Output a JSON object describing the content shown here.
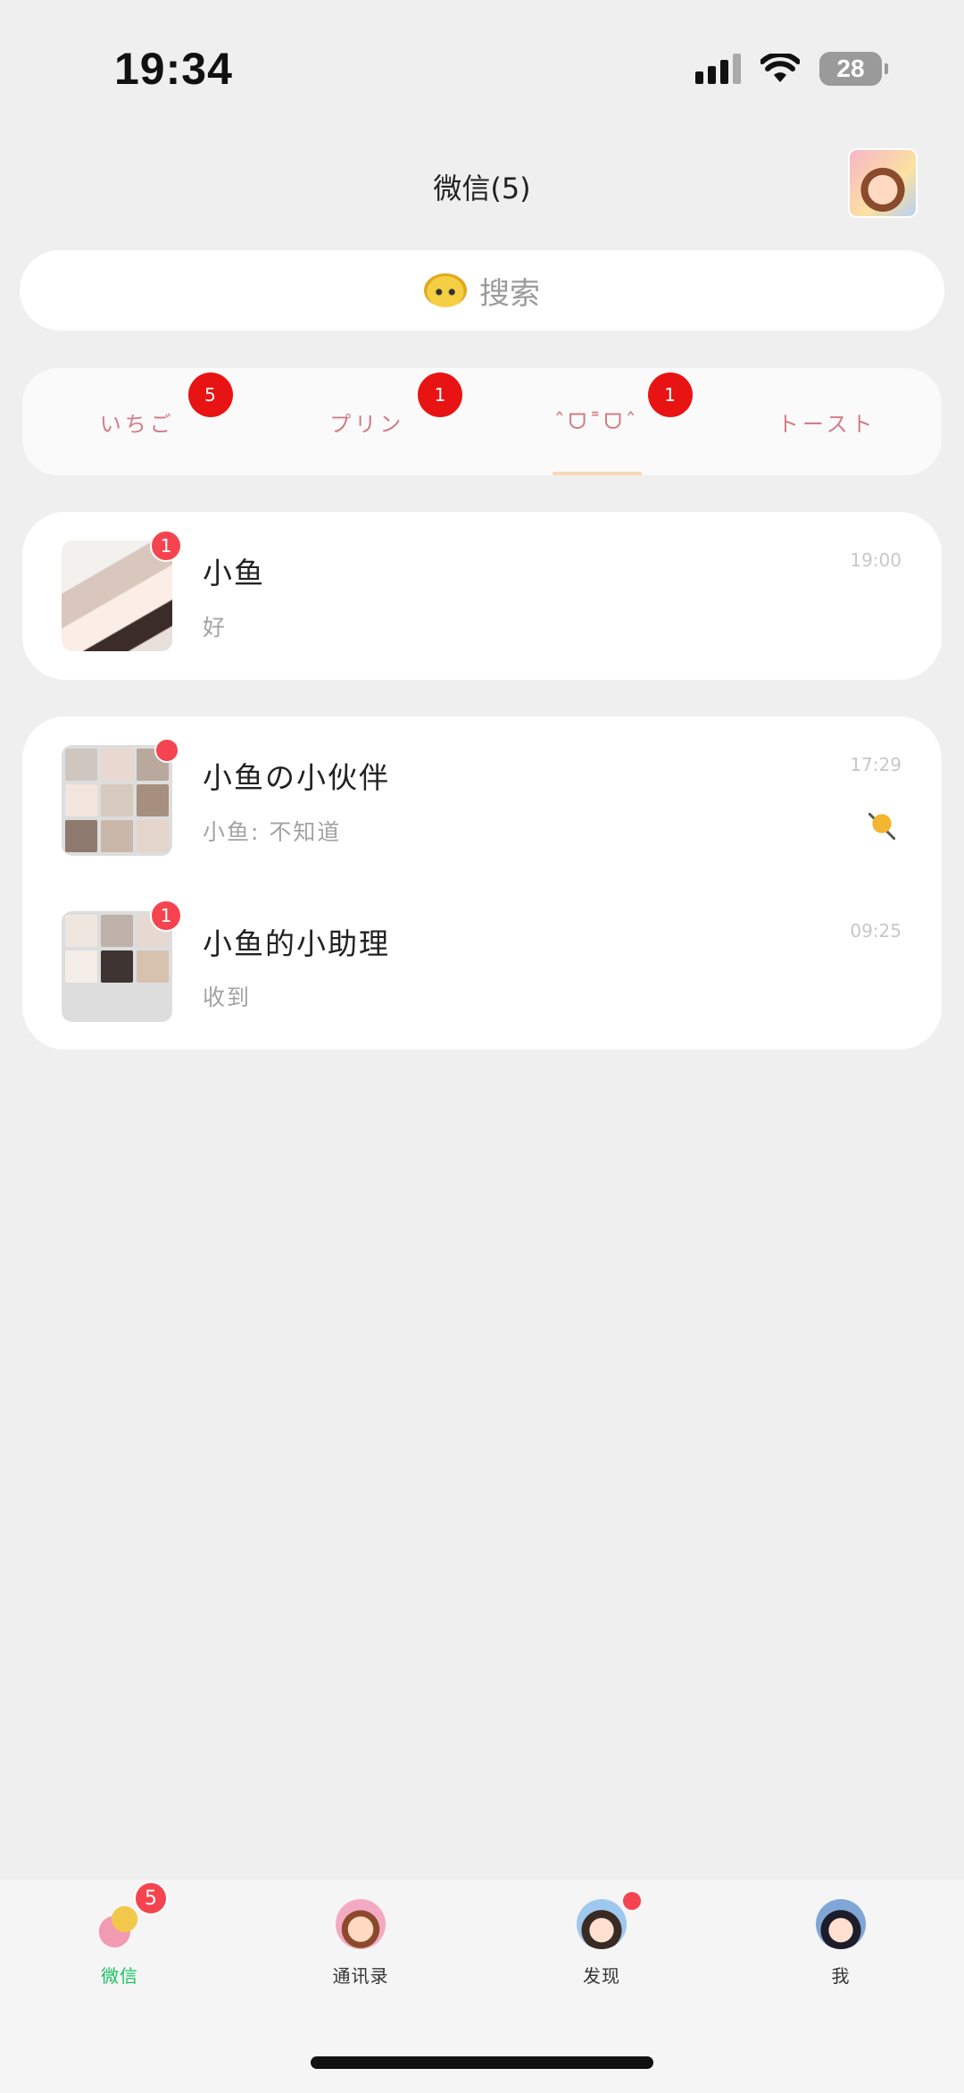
{
  "status_bar": {
    "time": "19:34",
    "battery": "28"
  },
  "nav": {
    "title": "微信(5)",
    "profile_icon": "anime-girl-avatar-icon"
  },
  "search": {
    "placeholder": "搜索",
    "icon": "kero-mascot-icon"
  },
  "tabs": [
    {
      "label": "いちご",
      "badge": "5"
    },
    {
      "label": "プリン",
      "badge": "1"
    },
    {
      "label": "ˆᗜ˭ᗜˆ",
      "badge": "1"
    },
    {
      "label": "トースト",
      "badge": ""
    }
  ],
  "chats_pinned": [
    {
      "name": "小鱼",
      "message": "好",
      "time": "19:00",
      "unread": "1"
    }
  ],
  "chats_groups": [
    {
      "name": "小鱼の小伙伴",
      "message": "小鱼: 不知道",
      "time": "17:29",
      "unread": "",
      "muted": true
    },
    {
      "name": "小鱼的小助理",
      "message": "收到",
      "time": "09:25",
      "unread": "1",
      "muted": false
    }
  ],
  "tabbar": [
    {
      "label": "微信",
      "badge": "5",
      "active": true,
      "icon": "cardcaptor-wand-icon"
    },
    {
      "label": "通讯录",
      "badge": "",
      "active": false,
      "icon": "anime-girl-contacts-icon"
    },
    {
      "label": "发现",
      "badge": "",
      "dot": true,
      "active": false,
      "icon": "anime-boy-discover-icon"
    },
    {
      "label": "我",
      "badge": "",
      "active": false,
      "icon": "anime-boy-me-icon"
    }
  ],
  "colors": {
    "accent_green": "#19c15f",
    "badge_red": "#e81414",
    "tab_text": "#d27d86"
  }
}
